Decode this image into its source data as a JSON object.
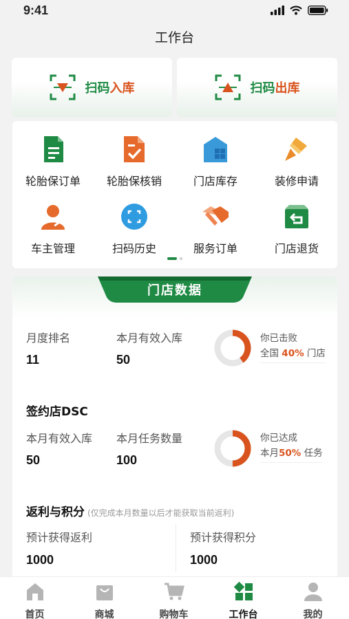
{
  "status_bar": {
    "time": "9:41"
  },
  "page": {
    "title": "工作台"
  },
  "scan_in": {
    "prefix": "扫码",
    "highlight": "入库"
  },
  "scan_out": {
    "prefix": "扫码",
    "highlight": "出库"
  },
  "menu": {
    "items": [
      {
        "label": "轮胎保订单",
        "icon": "document-icon"
      },
      {
        "label": "轮胎保核销",
        "icon": "checklist-icon"
      },
      {
        "label": "门店库存",
        "icon": "store-inventory-icon"
      },
      {
        "label": "装修申请",
        "icon": "paint-brush-icon"
      },
      {
        "label": "车主管理",
        "icon": "user-manage-icon"
      },
      {
        "label": "扫码历史",
        "icon": "scan-history-icon"
      },
      {
        "label": "服务订单",
        "icon": "handshake-icon"
      },
      {
        "label": "门店退货",
        "icon": "return-box-icon"
      }
    ]
  },
  "store_data": {
    "title": "门店数据",
    "monthly_rank_label": "月度排名",
    "monthly_rank_value": "11",
    "monthly_inbound_label": "本月有效入库",
    "monthly_inbound_value": "50",
    "beat_line1": "你已击败",
    "beat_line2_prefix": "全国",
    "beat_percent": "40%",
    "beat_line2_suffix": "门店",
    "beat_ratio": 0.4
  },
  "dsc": {
    "title": "签约店DSC",
    "inbound_label": "本月有效入库",
    "inbound_value": "50",
    "task_label": "本月任务数量",
    "task_value": "100",
    "reach_line1": "你已达成",
    "reach_line2_prefix": "本月",
    "reach_percent": "50%",
    "reach_line2_suffix": "任务",
    "reach_ratio": 0.5
  },
  "rebate": {
    "title": "返利与积分",
    "note": "(仅完成本月数量以后才能获取当前返利)",
    "rebate_label": "预计获得返利",
    "rebate_value": "1000",
    "points_label": "预计获得积分",
    "points_value": "1000"
  },
  "tabbar": {
    "items": [
      {
        "label": "首页",
        "icon": "home-icon"
      },
      {
        "label": "商城",
        "icon": "mall-bag-icon"
      },
      {
        "label": "购物车",
        "icon": "cart-icon"
      },
      {
        "label": "工作台",
        "icon": "workbench-grid-icon"
      },
      {
        "label": "我的",
        "icon": "profile-icon"
      }
    ],
    "active_index": 3
  },
  "colors": {
    "green": "#1f8a44",
    "orange": "#d9531e",
    "ring_track": "#e6e6e6"
  }
}
